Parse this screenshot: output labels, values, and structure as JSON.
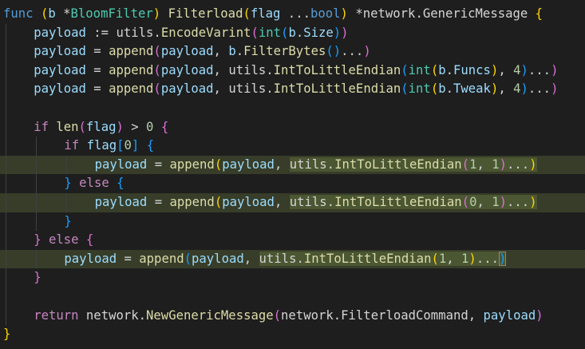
{
  "colors": {
    "background": "#1e1e1e",
    "highlight_line": "#373d29",
    "highlight_selection": "#4b5632",
    "keyword": "#569cd6",
    "control": "#c586c0",
    "function": "#dcdcaa",
    "type": "#4ec9b0",
    "variable": "#9cdcfe",
    "number": "#b5cea8",
    "plain": "#d4d4d4",
    "bracket_gold": "#ffd700",
    "bracket_pink": "#da70d6",
    "bracket_blue": "#179fff",
    "indent_guide": "#404040",
    "indent_guide_active": "#707070"
  },
  "code_lines": [
    {
      "indent": 0,
      "highlight": false,
      "tokens": [
        {
          "t": "func",
          "c": "keyword"
        },
        {
          "t": " ",
          "c": "plain"
        },
        {
          "t": "(",
          "c": "bracket_gold"
        },
        {
          "t": "b",
          "c": "variable"
        },
        {
          "t": " *",
          "c": "plain"
        },
        {
          "t": "BloomFilter",
          "c": "type"
        },
        {
          "t": ")",
          "c": "bracket_gold"
        },
        {
          "t": " ",
          "c": "plain"
        },
        {
          "t": "Filterload",
          "c": "function"
        },
        {
          "t": "(",
          "c": "bracket_gold"
        },
        {
          "t": "flag",
          "c": "variable"
        },
        {
          "t": " ...",
          "c": "plain"
        },
        {
          "t": "bool",
          "c": "keyword"
        },
        {
          "t": ")",
          "c": "bracket_gold"
        },
        {
          "t": " *",
          "c": "plain"
        },
        {
          "t": "network",
          "c": "plain"
        },
        {
          "t": ".",
          "c": "plain"
        },
        {
          "t": "GenericMessage",
          "c": "plain"
        },
        {
          "t": " ",
          "c": "plain"
        },
        {
          "t": "{",
          "c": "bracket_gold"
        }
      ]
    },
    {
      "indent": 1,
      "highlight": false,
      "tokens": [
        {
          "t": "payload",
          "c": "variable"
        },
        {
          "t": " := ",
          "c": "plain"
        },
        {
          "t": "utils",
          "c": "plain"
        },
        {
          "t": ".",
          "c": "plain"
        },
        {
          "t": "EncodeVarint",
          "c": "function"
        },
        {
          "t": "(",
          "c": "bracket_pink"
        },
        {
          "t": "int",
          "c": "type"
        },
        {
          "t": "(",
          "c": "bracket_blue"
        },
        {
          "t": "b",
          "c": "variable"
        },
        {
          "t": ".",
          "c": "plain"
        },
        {
          "t": "Size",
          "c": "variable"
        },
        {
          "t": ")",
          "c": "bracket_blue"
        },
        {
          "t": ")",
          "c": "bracket_pink"
        }
      ]
    },
    {
      "indent": 1,
      "highlight": false,
      "tokens": [
        {
          "t": "payload",
          "c": "variable"
        },
        {
          "t": " = ",
          "c": "plain"
        },
        {
          "t": "append",
          "c": "function"
        },
        {
          "t": "(",
          "c": "bracket_pink"
        },
        {
          "t": "payload",
          "c": "variable"
        },
        {
          "t": ", ",
          "c": "plain"
        },
        {
          "t": "b",
          "c": "variable"
        },
        {
          "t": ".",
          "c": "plain"
        },
        {
          "t": "FilterBytes",
          "c": "function"
        },
        {
          "t": "()",
          "c": "bracket_blue"
        },
        {
          "t": "...",
          "c": "plain"
        },
        {
          "t": ")",
          "c": "bracket_pink"
        }
      ]
    },
    {
      "indent": 1,
      "highlight": false,
      "tokens": [
        {
          "t": "payload",
          "c": "variable"
        },
        {
          "t": " = ",
          "c": "plain"
        },
        {
          "t": "append",
          "c": "function"
        },
        {
          "t": "(",
          "c": "bracket_pink"
        },
        {
          "t": "payload",
          "c": "variable"
        },
        {
          "t": ", ",
          "c": "plain"
        },
        {
          "t": "utils",
          "c": "plain"
        },
        {
          "t": ".",
          "c": "plain"
        },
        {
          "t": "IntToLittleEndian",
          "c": "function"
        },
        {
          "t": "(",
          "c": "bracket_blue"
        },
        {
          "t": "int",
          "c": "type"
        },
        {
          "t": "(",
          "c": "bracket_gold"
        },
        {
          "t": "b",
          "c": "variable"
        },
        {
          "t": ".",
          "c": "plain"
        },
        {
          "t": "Funcs",
          "c": "variable"
        },
        {
          "t": ")",
          "c": "bracket_gold"
        },
        {
          "t": ", ",
          "c": "plain"
        },
        {
          "t": "4",
          "c": "number"
        },
        {
          "t": ")",
          "c": "bracket_blue"
        },
        {
          "t": "...",
          "c": "plain"
        },
        {
          "t": ")",
          "c": "bracket_pink"
        }
      ]
    },
    {
      "indent": 1,
      "highlight": false,
      "tokens": [
        {
          "t": "payload",
          "c": "variable"
        },
        {
          "t": " = ",
          "c": "plain"
        },
        {
          "t": "append",
          "c": "function"
        },
        {
          "t": "(",
          "c": "bracket_pink"
        },
        {
          "t": "payload",
          "c": "variable"
        },
        {
          "t": ", ",
          "c": "plain"
        },
        {
          "t": "utils",
          "c": "plain"
        },
        {
          "t": ".",
          "c": "plain"
        },
        {
          "t": "IntToLittleEndian",
          "c": "function"
        },
        {
          "t": "(",
          "c": "bracket_blue"
        },
        {
          "t": "int",
          "c": "type"
        },
        {
          "t": "(",
          "c": "bracket_gold"
        },
        {
          "t": "b",
          "c": "variable"
        },
        {
          "t": ".",
          "c": "plain"
        },
        {
          "t": "Tweak",
          "c": "variable"
        },
        {
          "t": ")",
          "c": "bracket_gold"
        },
        {
          "t": ", ",
          "c": "plain"
        },
        {
          "t": "4",
          "c": "number"
        },
        {
          "t": ")",
          "c": "bracket_blue"
        },
        {
          "t": "...",
          "c": "plain"
        },
        {
          "t": ")",
          "c": "bracket_pink"
        }
      ]
    },
    {
      "indent": 0,
      "highlight": false,
      "tokens": []
    },
    {
      "indent": 1,
      "highlight": false,
      "tokens": [
        {
          "t": "if",
          "c": "control"
        },
        {
          "t": " ",
          "c": "plain"
        },
        {
          "t": "len",
          "c": "function"
        },
        {
          "t": "(",
          "c": "bracket_pink"
        },
        {
          "t": "flag",
          "c": "variable"
        },
        {
          "t": ")",
          "c": "bracket_pink"
        },
        {
          "t": " > ",
          "c": "plain"
        },
        {
          "t": "0",
          "c": "number"
        },
        {
          "t": " ",
          "c": "plain"
        },
        {
          "t": "{",
          "c": "bracket_pink"
        }
      ]
    },
    {
      "indent": 2,
      "highlight": false,
      "tokens": [
        {
          "t": "if",
          "c": "control"
        },
        {
          "t": " ",
          "c": "plain"
        },
        {
          "t": "flag",
          "c": "variable"
        },
        {
          "t": "[",
          "c": "bracket_blue"
        },
        {
          "t": "0",
          "c": "number"
        },
        {
          "t": "]",
          "c": "bracket_blue"
        },
        {
          "t": " ",
          "c": "plain"
        },
        {
          "t": "{",
          "c": "bracket_blue"
        }
      ]
    },
    {
      "indent": 3,
      "highlight": true,
      "tokens": [
        {
          "t": "payload",
          "c": "variable"
        },
        {
          "t": " = ",
          "c": "plain"
        },
        {
          "t": "append",
          "c": "function"
        },
        {
          "t": "(",
          "c": "bracket_gold"
        },
        {
          "t": "payload",
          "c": "variable"
        },
        {
          "t": ", ",
          "c": "plain"
        },
        {
          "t": "utils",
          "c": "plain",
          "box": true
        },
        {
          "t": ".",
          "c": "plain",
          "box": true
        },
        {
          "t": "IntToLittleEndian",
          "c": "function",
          "box": true
        },
        {
          "t": "(",
          "c": "bracket_pink",
          "box": true
        },
        {
          "t": "1",
          "c": "number",
          "box": true
        },
        {
          "t": ", ",
          "c": "plain",
          "box": true
        },
        {
          "t": "1",
          "c": "number",
          "box": true
        },
        {
          "t": ")",
          "c": "bracket_pink",
          "box": true
        },
        {
          "t": "...",
          "c": "plain",
          "box": true
        },
        {
          "t": ")",
          "c": "bracket_gold",
          "box": true
        }
      ]
    },
    {
      "indent": 2,
      "highlight": false,
      "tokens": [
        {
          "t": "}",
          "c": "bracket_blue"
        },
        {
          "t": " ",
          "c": "plain"
        },
        {
          "t": "else",
          "c": "control"
        },
        {
          "t": " ",
          "c": "plain"
        },
        {
          "t": "{",
          "c": "bracket_blue"
        }
      ]
    },
    {
      "indent": 3,
      "highlight": true,
      "tokens": [
        {
          "t": "payload",
          "c": "variable"
        },
        {
          "t": " = ",
          "c": "plain"
        },
        {
          "t": "append",
          "c": "function"
        },
        {
          "t": "(",
          "c": "bracket_gold"
        },
        {
          "t": "payload",
          "c": "variable"
        },
        {
          "t": ", ",
          "c": "plain"
        },
        {
          "t": "utils",
          "c": "plain",
          "box": true
        },
        {
          "t": ".",
          "c": "plain",
          "box": true
        },
        {
          "t": "IntToLittleEndian",
          "c": "function",
          "box": true
        },
        {
          "t": "(",
          "c": "bracket_pink",
          "box": true
        },
        {
          "t": "0",
          "c": "number",
          "box": true
        },
        {
          "t": ", ",
          "c": "plain",
          "box": true
        },
        {
          "t": "1",
          "c": "number",
          "box": true
        },
        {
          "t": ")",
          "c": "bracket_pink",
          "box": true
        },
        {
          "t": "...",
          "c": "plain",
          "box": true
        },
        {
          "t": ")",
          "c": "bracket_gold",
          "box": true
        }
      ]
    },
    {
      "indent": 2,
      "highlight": false,
      "tokens": [
        {
          "t": "}",
          "c": "bracket_blue"
        }
      ]
    },
    {
      "indent": 1,
      "highlight": false,
      "tokens": [
        {
          "t": "}",
          "c": "bracket_pink"
        },
        {
          "t": " ",
          "c": "plain"
        },
        {
          "t": "else",
          "c": "control"
        },
        {
          "t": " ",
          "c": "plain"
        },
        {
          "t": "{",
          "c": "bracket_pink"
        }
      ]
    },
    {
      "indent": 2,
      "highlight": true,
      "tokens": [
        {
          "t": "payload",
          "c": "variable"
        },
        {
          "t": " = ",
          "c": "plain"
        },
        {
          "t": "append",
          "c": "function"
        },
        {
          "t": "(",
          "c": "bracket_blue"
        },
        {
          "t": "payload",
          "c": "variable"
        },
        {
          "t": ", ",
          "c": "plain"
        },
        {
          "t": "utils",
          "c": "plain",
          "box": true
        },
        {
          "t": ".",
          "c": "plain",
          "box": true
        },
        {
          "t": "IntToLittleEndian",
          "c": "function",
          "box": true
        },
        {
          "t": "(",
          "c": "bracket_gold",
          "box": true
        },
        {
          "t": "1",
          "c": "number",
          "box": true
        },
        {
          "t": ", ",
          "c": "plain",
          "box": true
        },
        {
          "t": "1",
          "c": "number",
          "box": true
        },
        {
          "t": ")",
          "c": "bracket_gold",
          "box": true
        },
        {
          "t": "...",
          "c": "plain",
          "box": true
        },
        {
          "t": ")",
          "c": "bracket_blue",
          "box": true,
          "match": true
        }
      ]
    },
    {
      "indent": 1,
      "highlight": false,
      "tokens": [
        {
          "t": "}",
          "c": "bracket_pink"
        }
      ]
    },
    {
      "indent": 0,
      "highlight": false,
      "tokens": []
    },
    {
      "indent": 1,
      "highlight": false,
      "tokens": [
        {
          "t": "return",
          "c": "control"
        },
        {
          "t": " ",
          "c": "plain"
        },
        {
          "t": "network",
          "c": "plain"
        },
        {
          "t": ".",
          "c": "plain"
        },
        {
          "t": "NewGenericMessage",
          "c": "function"
        },
        {
          "t": "(",
          "c": "bracket_pink"
        },
        {
          "t": "network",
          "c": "plain"
        },
        {
          "t": ".",
          "c": "plain"
        },
        {
          "t": "FilterloadCommand",
          "c": "plain"
        },
        {
          "t": ", ",
          "c": "plain"
        },
        {
          "t": "payload",
          "c": "variable"
        },
        {
          "t": ")",
          "c": "bracket_pink"
        }
      ]
    },
    {
      "indent": 0,
      "highlight": false,
      "tokens": [
        {
          "t": "}",
          "c": "bracket_gold"
        }
      ]
    }
  ]
}
